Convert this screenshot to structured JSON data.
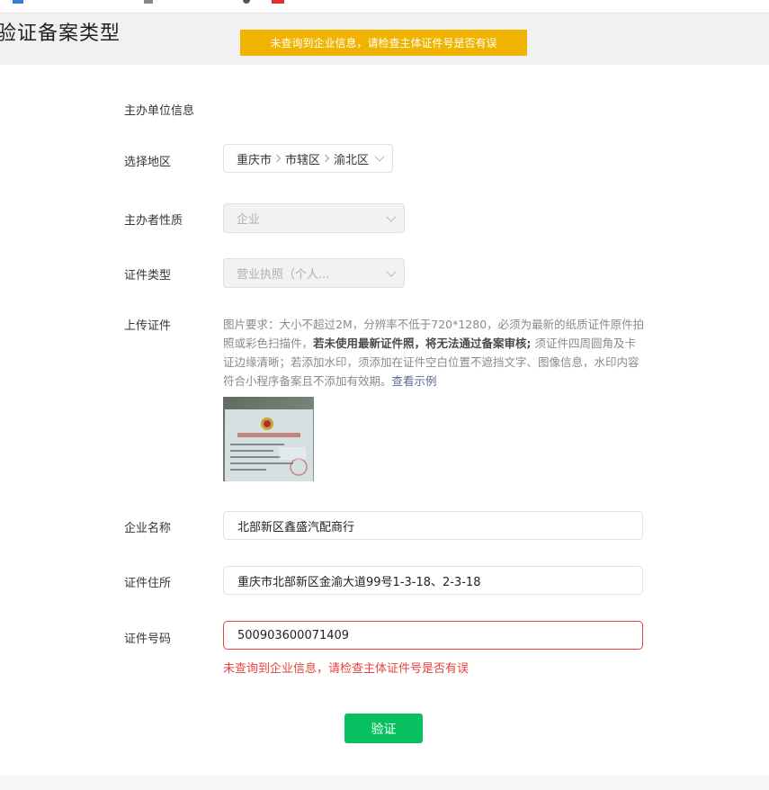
{
  "page_title": "验证备案类型",
  "toast_message": "未查询到企业信息，请检查主体证件号是否有误",
  "section_title": "主办单位信息",
  "labels": {
    "region": "选择地区",
    "organizer_type": "主办者性质",
    "cert_type": "证件类型",
    "upload_cert": "上传证件",
    "company_name": "企业名称",
    "cert_address": "证件住所",
    "cert_number": "证件号码"
  },
  "region": {
    "province": "重庆市",
    "city": "市辖区",
    "district": "渝北区"
  },
  "organizer_type_value": "企业",
  "cert_type_value": "营业执照（个人...",
  "upload": {
    "req_prefix": "图片要求：大小不超过2M，分辨率不低于720*1280，必须为最新的纸质证件原件拍照或彩色扫描件，",
    "req_bold": "若未使用最新证件照，将无法通过备案审核;",
    "req_suffix": " 须证件四周圆角及卡证边缘清晰；若添加水印，须添加在证件空白位置不遮挡文字、图像信息，水印内容符合小程序备案且不添加有效期。",
    "example_link": "查看示例"
  },
  "fields": {
    "company_name": "北部新区鑫盛汽配商行",
    "cert_address": "重庆市北部新区金渝大道99号1-3-18、2-3-18",
    "cert_number": "500903600071409"
  },
  "error_message": "未查询到企业信息，请检查主体证件号是否有误",
  "verify_button": "验证",
  "colors": {
    "warning": "#f0b400",
    "primary": "#07c160",
    "error": "#e64340",
    "link": "#576b95"
  }
}
